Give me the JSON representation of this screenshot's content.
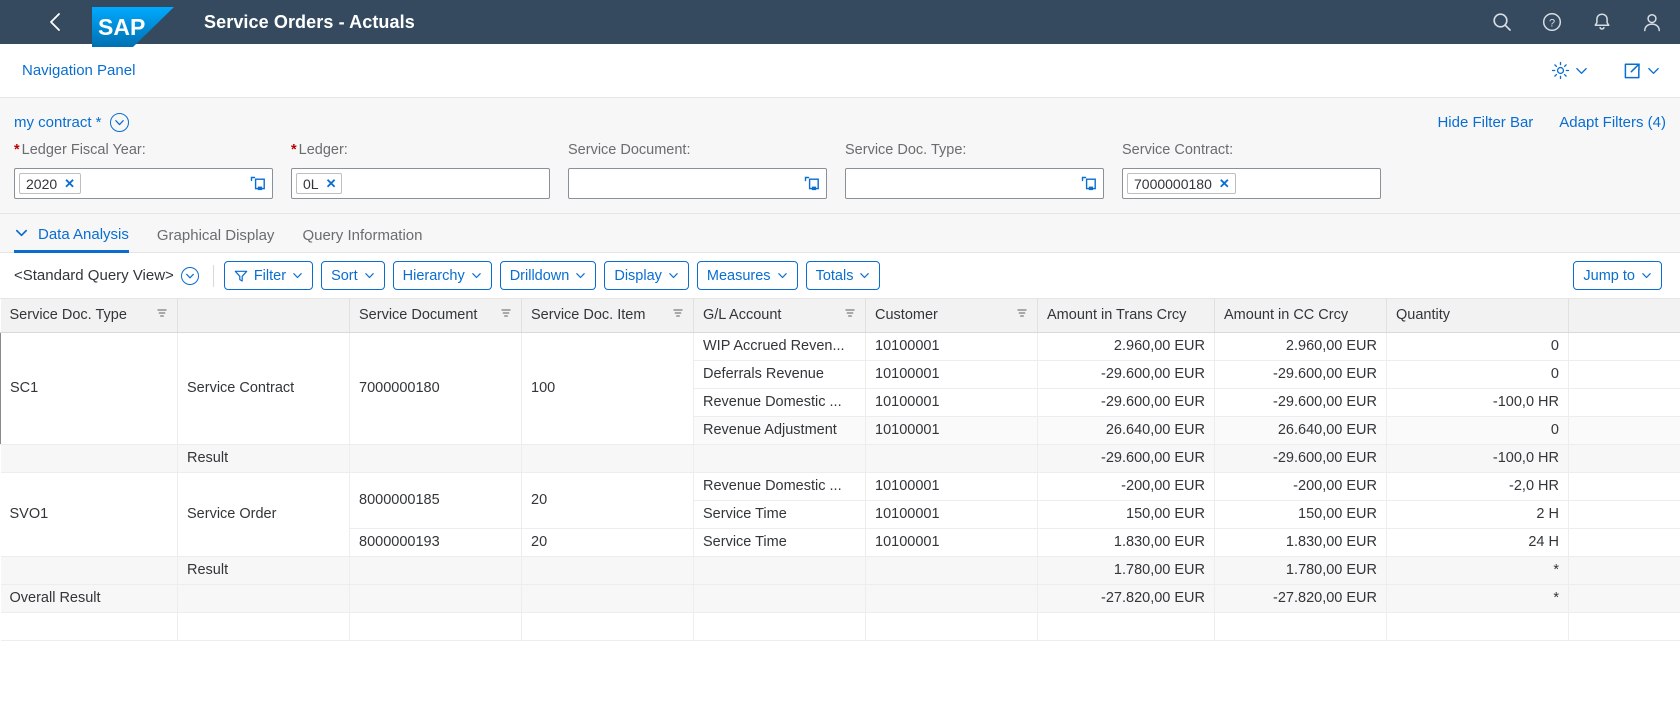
{
  "shell": {
    "title": "Service Orders - Actuals",
    "back_icon": "back-chevron-icon",
    "logo_text": "SAP",
    "icons": [
      "search-icon",
      "help-icon",
      "notifications-bell-icon",
      "user-avatar-icon"
    ]
  },
  "sub_header": {
    "nav_panel_label": "Navigation Panel",
    "settings_icon": "gear-icon",
    "share_icon": "share-export-icon"
  },
  "filter_bar": {
    "variant_label": "my contract *",
    "variant_icon": "chevron-down-circle-icon",
    "hide_filter_bar": "Hide Filter Bar",
    "adapt_filters": "Adapt Filters (4)",
    "fields": [
      {
        "label": "Ledger Fiscal Year:",
        "required": true,
        "tokens": [
          "2020"
        ],
        "value_help": true,
        "placeholder": ""
      },
      {
        "label": "Ledger:",
        "required": true,
        "tokens": [
          "0L"
        ],
        "value_help": false,
        "placeholder": ""
      },
      {
        "label": "Service Document:",
        "required": false,
        "tokens": [],
        "value_help": true,
        "placeholder": ""
      },
      {
        "label": "Service Doc. Type:",
        "required": false,
        "tokens": [],
        "value_help": true,
        "placeholder": ""
      },
      {
        "label": "Service Contract:",
        "required": false,
        "tokens": [
          "7000000180"
        ],
        "value_help": false,
        "placeholder": ""
      }
    ]
  },
  "tabs": [
    {
      "label": "Data Analysis",
      "active": true,
      "icon": "chevron-down-icon"
    },
    {
      "label": "Graphical Display",
      "active": false,
      "icon": ""
    },
    {
      "label": "Query Information",
      "active": false,
      "icon": ""
    }
  ],
  "toolbar": {
    "query_view": "<Standard Query View>",
    "query_view_icon": "chevron-down-circle-icon",
    "buttons": [
      {
        "label": "Filter",
        "icon": "filter-funnel-icon",
        "chevron": true
      },
      {
        "label": "Sort",
        "icon": "",
        "chevron": true
      },
      {
        "label": "Hierarchy",
        "icon": "",
        "chevron": true
      },
      {
        "label": "Drilldown",
        "icon": "",
        "chevron": true
      },
      {
        "label": "Display",
        "icon": "",
        "chevron": true
      },
      {
        "label": "Measures",
        "icon": "",
        "chevron": true
      },
      {
        "label": "Totals",
        "icon": "",
        "chevron": true
      }
    ],
    "jump_to": {
      "label": "Jump to",
      "chevron": true
    }
  },
  "table": {
    "columns": [
      {
        "key": "service_doc_type",
        "label": "Service Doc. Type",
        "sort_glyph": true,
        "numeric": false
      },
      {
        "key": "service_doc_type_text",
        "label": "",
        "sort_glyph": false,
        "numeric": false
      },
      {
        "key": "service_document",
        "label": "Service Document",
        "sort_glyph": true,
        "numeric": false
      },
      {
        "key": "service_doc_item",
        "label": "Service Doc. Item",
        "sort_glyph": true,
        "numeric": false
      },
      {
        "key": "gl_account",
        "label": "G/L Account",
        "sort_glyph": true,
        "numeric": false
      },
      {
        "key": "customer",
        "label": "Customer",
        "sort_glyph": true,
        "numeric": false
      },
      {
        "key": "amount_trans_crcy",
        "label": "Amount in Trans Crcy",
        "sort_glyph": false,
        "numeric": true
      },
      {
        "key": "amount_cc_crcy",
        "label": "Amount in CC Crcy",
        "sort_glyph": false,
        "numeric": true
      },
      {
        "key": "quantity",
        "label": "Quantity",
        "sort_glyph": false,
        "numeric": true
      },
      {
        "key": "extra",
        "label": "",
        "sort_glyph": false,
        "numeric": true
      }
    ],
    "groups": [
      {
        "doc_type_code": "SC1",
        "doc_type_text": "Service Contract",
        "selected": true,
        "rows": [
          {
            "service_document": "7000000180",
            "service_doc_item": "100",
            "gl_account": "WIP Accrued Reven...",
            "customer": "10100001",
            "amount_trans_crcy": "2.960,00 EUR",
            "amount_cc_crcy": "2.960,00 EUR",
            "quantity": "0",
            "alt": false
          },
          {
            "service_document": "",
            "service_doc_item": "",
            "gl_account": "Deferrals Revenue",
            "customer": "10100001",
            "amount_trans_crcy": "-29.600,00 EUR",
            "amount_cc_crcy": "-29.600,00 EUR",
            "quantity": "0",
            "alt": false
          },
          {
            "service_document": "",
            "service_doc_item": "",
            "gl_account": "Revenue Domestic ...",
            "customer": "10100001",
            "amount_trans_crcy": "-29.600,00 EUR",
            "amount_cc_crcy": "-29.600,00 EUR",
            "quantity": "-100,0 HR",
            "alt": false
          },
          {
            "service_document": "",
            "service_doc_item": "",
            "gl_account": "Revenue Adjustment",
            "customer": "10100001",
            "amount_trans_crcy": "26.640,00 EUR",
            "amount_cc_crcy": "26.640,00 EUR",
            "quantity": "0",
            "alt": true
          }
        ],
        "result": {
          "label": "Result",
          "amount_trans_crcy": "-29.600,00 EUR",
          "amount_cc_crcy": "-29.600,00 EUR",
          "quantity": "-100,0 HR"
        }
      },
      {
        "doc_type_code": "SVO1",
        "doc_type_text": "Service Order",
        "selected": false,
        "rows": [
          {
            "service_document": "8000000185",
            "service_doc_item": "20",
            "gl_account": "Revenue Domestic ...",
            "customer": "10100001",
            "amount_trans_crcy": "-200,00 EUR",
            "amount_cc_crcy": "-200,00 EUR",
            "quantity": "-2,0 HR",
            "alt": false
          },
          {
            "service_document": "",
            "service_doc_item": "",
            "gl_account": "Service Time",
            "customer": "10100001",
            "amount_trans_crcy": "150,00 EUR",
            "amount_cc_crcy": "150,00 EUR",
            "quantity": "2 H",
            "alt": false
          },
          {
            "service_document": "8000000193",
            "service_doc_item": "20",
            "gl_account": "Service Time",
            "customer": "10100001",
            "amount_trans_crcy": "1.830,00 EUR",
            "amount_cc_crcy": "1.830,00 EUR",
            "quantity": "24 H",
            "alt": false
          }
        ],
        "result": {
          "label": "Result",
          "amount_trans_crcy": "1.780,00 EUR",
          "amount_cc_crcy": "1.780,00 EUR",
          "quantity": "*"
        }
      }
    ],
    "overall": {
      "label": "Overall Result",
      "amount_trans_crcy": "-27.820,00 EUR",
      "amount_cc_crcy": "-27.820,00 EUR",
      "quantity": "*"
    }
  },
  "colors": {
    "shell_bg": "#354a5f",
    "accent": "#0a6ed1",
    "total_highlight": "#eba850",
    "required_star": "#bb0000"
  }
}
